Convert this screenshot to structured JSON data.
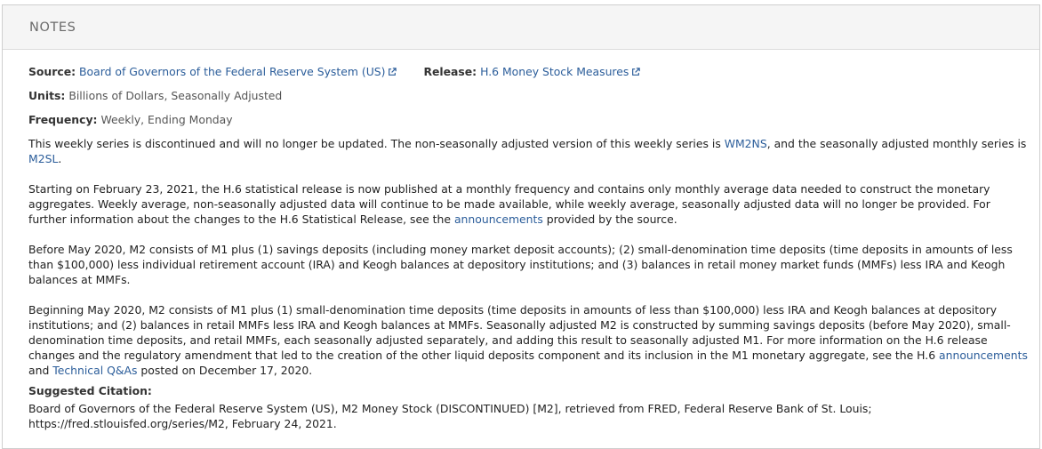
{
  "panel": {
    "title": "NOTES"
  },
  "source": {
    "label": "Source:",
    "value": "Board of Governors of the Federal Reserve System (US)",
    "icon": "external-link-icon"
  },
  "release": {
    "label": "Release:",
    "value": "H.6 Money Stock Measures",
    "icon": "external-link-icon"
  },
  "units": {
    "label": "Units:",
    "value": "Billions of Dollars, Seasonally Adjusted"
  },
  "frequency": {
    "label": "Frequency:",
    "value": "Weekly, Ending Monday"
  },
  "p1": {
    "t1": "This weekly series is discontinued and will no longer be updated. The non-seasonally adjusted version of this weekly series is ",
    "link1": "WM2NS",
    "t2": ", and the seasonally adjusted monthly series is ",
    "link2": "M2SL",
    "t3": "."
  },
  "p2": {
    "t1": "Starting on February 23, 2021, the H.6 statistical release is now published at a monthly frequency and contains only monthly average data needed to construct the monetary aggregates. Weekly average, non-seasonally adjusted data will continue to be made available, while weekly average, seasonally adjusted data will no longer be provided. For further information about the changes to the H.6 Statistical Release, see the ",
    "link": "announcements",
    "t2": " provided by the source."
  },
  "p3": "Before May 2020, M2 consists of M1 plus (1) savings deposits (including money market deposit accounts); (2) small-denomination time deposits (time deposits in amounts of less than $100,000) less individual retirement account (IRA) and Keogh balances at depository institutions; and (3) balances in retail money market funds (MMFs) less IRA and Keogh balances at MMFs.",
  "p4": {
    "t1": "Beginning May 2020, M2 consists of M1 plus (1) small-denomination time deposits (time deposits in amounts of less than $100,000) less IRA and Keogh balances at depository institutions; and (2) balances in retail MMFs less IRA and Keogh balances at MMFs. Seasonally adjusted M2 is constructed by summing savings deposits (before May 2020), small-denomination time deposits, and retail MMFs, each seasonally adjusted separately, and adding this result to seasonally adjusted M1. For more information on the H.6 release changes and the regulatory amendment that led to the creation of the other liquid deposits component and its inclusion in the M1 monetary aggregate, see the H.6 ",
    "link1": "announcements",
    "t2": " and ",
    "link2": "Technical Q&As",
    "t3": " posted on December 17, 2020."
  },
  "citation": {
    "label": "Suggested Citation:",
    "text": "Board of Governors of the Federal Reserve System (US), M2 Money Stock (DISCONTINUED) [M2], retrieved from FRED, Federal Reserve Bank of St. Louis; https://fred.stlouisfed.org/series/M2, February 24, 2021."
  }
}
